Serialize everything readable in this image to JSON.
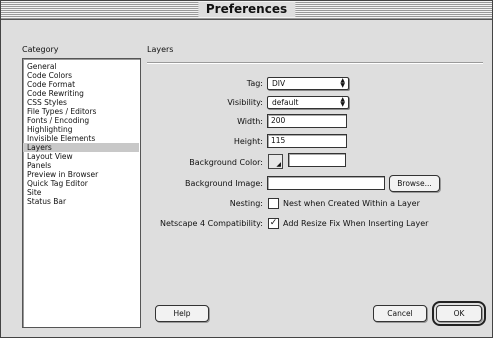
{
  "window": {
    "title": "Preferences"
  },
  "category": {
    "header": "Category",
    "items": [
      "General",
      "Code Colors",
      "Code Format",
      "Code Rewriting",
      "CSS Styles",
      "File Types / Editors",
      "Fonts / Encoding",
      "Highlighting",
      "Invisible Elements",
      "Layers",
      "Layout View",
      "Panels",
      "Preview in Browser",
      "Quick Tag Editor",
      "Site",
      "Status Bar"
    ],
    "selected": "Layers"
  },
  "panel": {
    "title": "Layers",
    "tag": {
      "label": "Tag:",
      "value": "DIV"
    },
    "visibility": {
      "label": "Visibility:",
      "value": "default"
    },
    "width": {
      "label": "Width:",
      "value": "200"
    },
    "height": {
      "label": "Height:",
      "value": "115"
    },
    "background_color": {
      "label": "Background Color:",
      "value": ""
    },
    "background_image": {
      "label": "Background Image:",
      "value": "",
      "browse_label": "Browse..."
    },
    "nesting": {
      "label": "Nesting:",
      "checkbox_label": "Nest when Created Within a Layer",
      "checked": false
    },
    "netscape": {
      "label": "Netscape 4 Compatibility:",
      "checkbox_label": "Add Resize Fix When Inserting Layer",
      "checked": true
    }
  },
  "buttons": {
    "help": "Help",
    "cancel": "Cancel",
    "ok": "OK"
  },
  "icons": {
    "popup_arrows": "up-down-arrows-icon",
    "checkmark": "checkmark-icon",
    "color_picker": "color-picker-icon"
  }
}
